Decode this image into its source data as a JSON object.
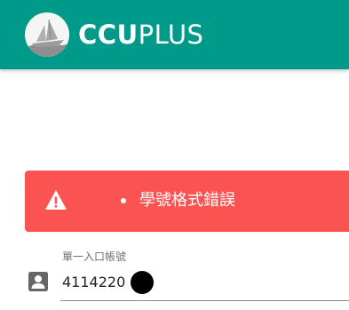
{
  "header": {
    "brand_bold": "CCU",
    "brand_light": "PLUS",
    "logo_icon": "sailboat-logo-icon",
    "background_color": "#009a8a"
  },
  "alert": {
    "message": "學號格式錯誤",
    "icon": "warning-triangle-icon",
    "background_color": "#fa5352"
  },
  "login_form": {
    "account_field": {
      "label": "單一入口帳號",
      "value": "4114220",
      "icon": "account-box-icon"
    }
  }
}
